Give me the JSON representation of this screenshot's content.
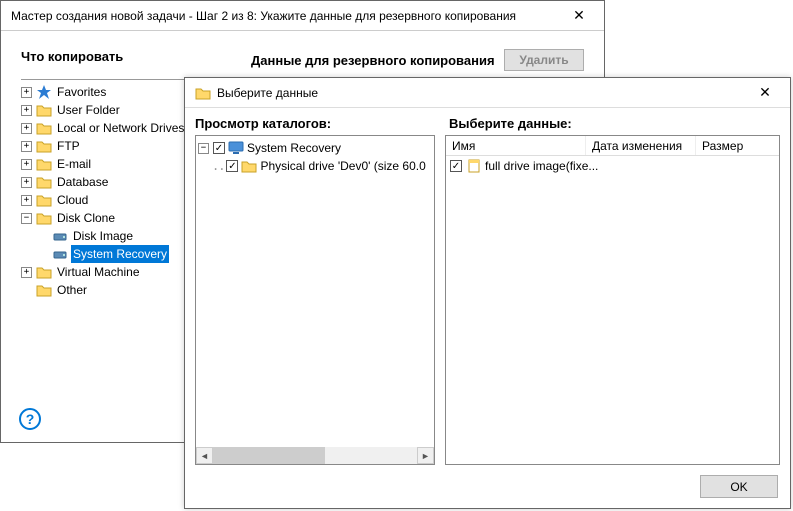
{
  "main": {
    "title": "Мастер создания новой задачи - Шаг 2 из 8: Укажите данные для резервного копирования",
    "header_left": "Что копировать",
    "header_right": "Данные для резервного копирования",
    "delete_btn": "Удалить",
    "help": "?"
  },
  "tree": [
    {
      "exp": "+",
      "icon": "star",
      "label": "Favorites",
      "indent": 0
    },
    {
      "exp": "+",
      "icon": "folder",
      "label": "User Folder",
      "indent": 0
    },
    {
      "exp": "+",
      "icon": "folder",
      "label": "Local or Network Drives",
      "indent": 0
    },
    {
      "exp": "+",
      "icon": "folder",
      "label": "FTP",
      "indent": 0
    },
    {
      "exp": "+",
      "icon": "folder",
      "label": "E-mail",
      "indent": 0
    },
    {
      "exp": "+",
      "icon": "folder",
      "label": "Database",
      "indent": 0
    },
    {
      "exp": "+",
      "icon": "folder",
      "label": "Cloud",
      "indent": 0
    },
    {
      "exp": "−",
      "icon": "folder",
      "label": "Disk Clone",
      "indent": 0
    },
    {
      "exp": " ",
      "icon": "disk",
      "label": "Disk Image",
      "indent": 1
    },
    {
      "exp": " ",
      "icon": "disk",
      "label": "System Recovery",
      "indent": 1,
      "selected": true
    },
    {
      "exp": "+",
      "icon": "folder",
      "label": "Virtual Machine",
      "indent": 0
    },
    {
      "exp": " ",
      "icon": "folder",
      "label": "Other",
      "indent": 0
    }
  ],
  "modal": {
    "title": "Выберите данные",
    "left_header": "Просмотр каталогов:",
    "right_header": "Выберите данные:",
    "ok": "OK",
    "browse": [
      {
        "exp": "−",
        "checked": true,
        "icon": "monitor",
        "label": "System Recovery",
        "indent": 0
      },
      {
        "exp": " ",
        "checked": true,
        "icon": "folder",
        "label": "Physical drive 'Dev0' (size 60.0",
        "indent": 1,
        "dots": true
      }
    ],
    "columns": {
      "c1": "Имя",
      "c2": "Дата изменения",
      "c3": "Размер"
    },
    "files": [
      {
        "checked": true,
        "label": "full drive image(fixe..."
      }
    ]
  }
}
